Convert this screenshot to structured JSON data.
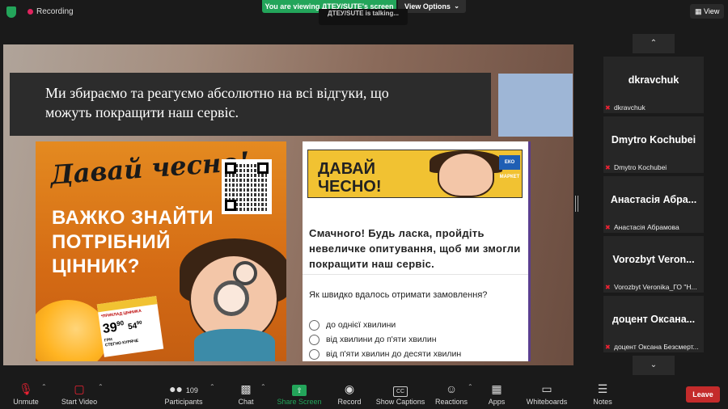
{
  "topbar": {
    "recording_label": "Recording",
    "viewing_label": "You are viewing ДТЕУ/SUTE's screen",
    "view_options_label": "View Options",
    "talking_label": "ДТЕУ/SUTE is talking...",
    "view_label": "View"
  },
  "slide": {
    "title_line1": "Ми збираємо та реагуємо абсолютно на всі відгуки, що",
    "title_line2": "можуть покращити наш сервіс.",
    "poster": {
      "script_text": "Давай чесно!",
      "main_line1": "ВАЖКО ЗНАЙТИ",
      "main_line2": "ПОТРІБНИЙ",
      "main_line3": "ЦІННИК?",
      "price_label": "*ПРИКЛАД ЦІННИКА",
      "price_value": "39",
      "price_cents": "90",
      "price_unit": "ГРН",
      "price_value2": "54",
      "price_cents2": "90",
      "price_product": "СТЕГНО КУРЯЧЕ"
    },
    "survey": {
      "banner_line1": "ДАВАЙ",
      "banner_line2": "ЧЕСНО!",
      "brand_label": "ЕКО МАРКЕТ",
      "intro": "Смачного! Будь ласка, пройдіть невеличке опитування, щоб ми змогли покращити наш сервіс.",
      "question": "Як швидко вдалось отримати замовлення?",
      "options": [
        "до однієї хвилини",
        "від хвилини до п'яти хвилин",
        "від п'яти хвилин до десяти хвилин"
      ]
    }
  },
  "participants_panel": {
    "tiles": [
      {
        "name": "dkravchuk",
        "sub": "dkravchuk"
      },
      {
        "name": "Dmytro Kochubei",
        "sub": "Dmytro Kochubei"
      },
      {
        "name": "Анастасія Абра...",
        "sub": "Анастасія Абрамова"
      },
      {
        "name": "Vorozbyt Veron...",
        "sub": "Vorozbyt Veronika_ГО \"Н..."
      },
      {
        "name": "доцент Оксана...",
        "sub": "доцент Оксана Безсмерт..."
      }
    ]
  },
  "toolbar": {
    "unmute": "Unmute",
    "start_video": "Start Video",
    "participants": "Participants",
    "participants_count": "109",
    "chat": "Chat",
    "share_screen": "Share Screen",
    "record": "Record",
    "show_captions": "Show Captions",
    "reactions": "Reactions",
    "apps": "Apps",
    "whiteboards": "Whiteboards",
    "notes": "Notes",
    "leave": "Leave"
  },
  "colors": {
    "accent_green": "#23a55a",
    "leave_red": "#c42b2b",
    "recording_red": "#e0245e"
  }
}
